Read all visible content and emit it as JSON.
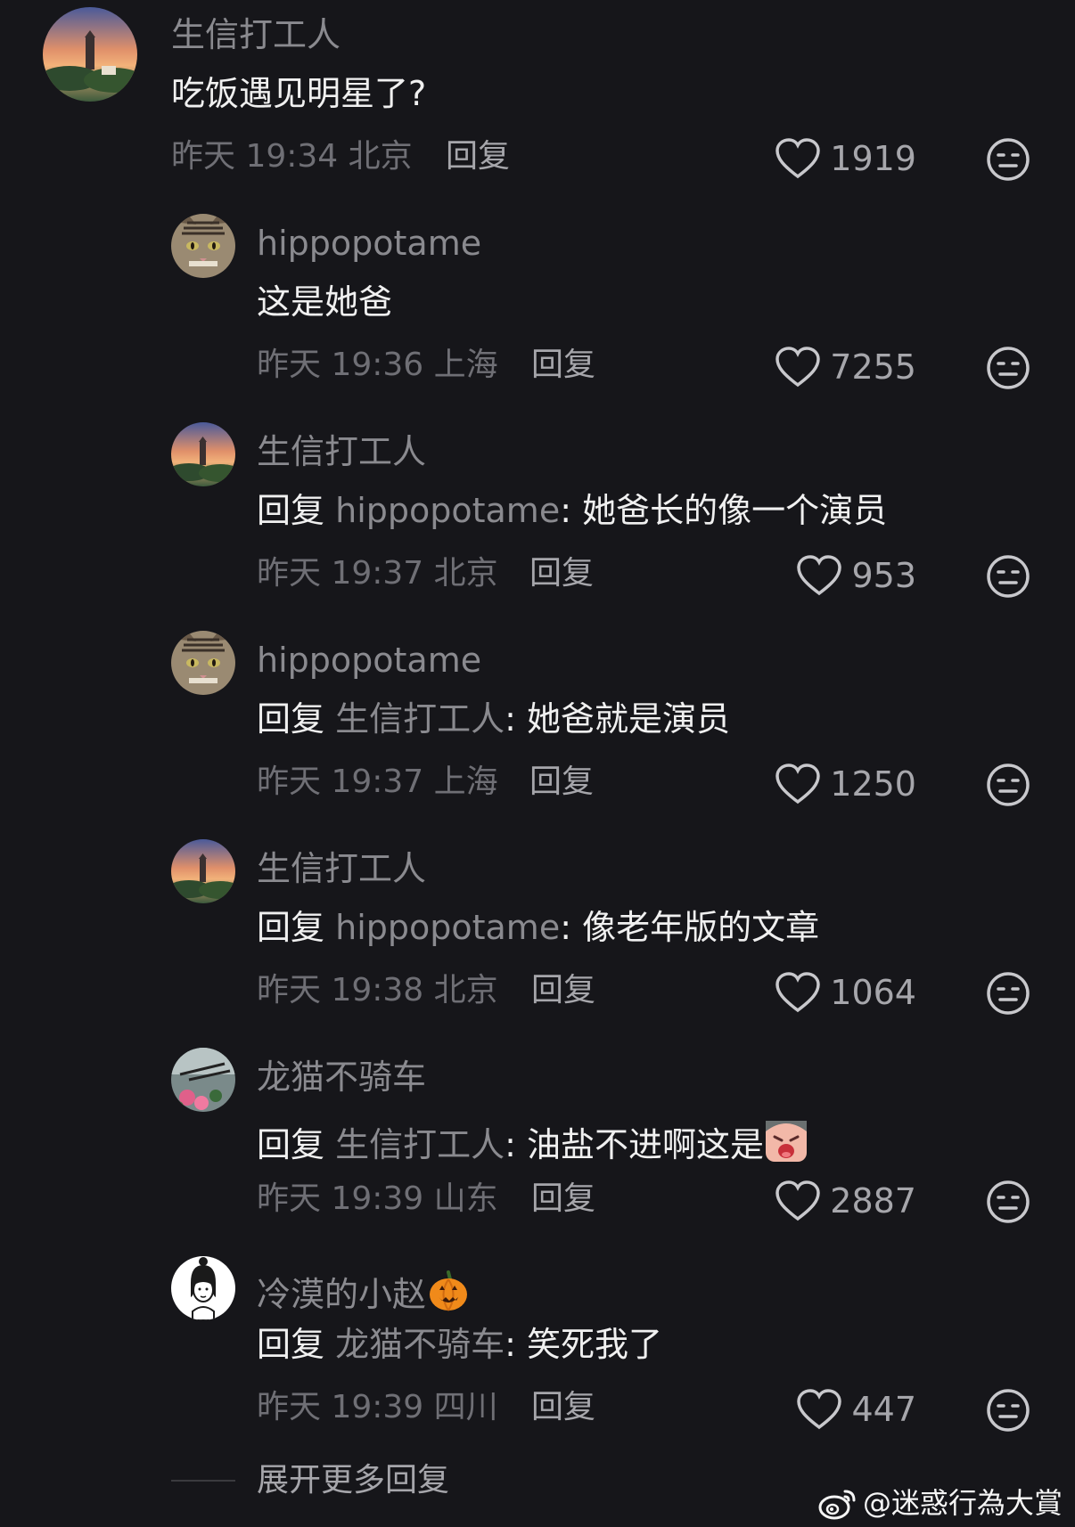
{
  "comments": [
    {
      "username": "生信打工人",
      "text": "吃饭遇见明星了?",
      "reply_prefix": "",
      "reply_target": "",
      "time": "昨天 19:34 北京",
      "reply_label": "回复",
      "likes": "1919",
      "avatar": "sunset-tower-avatar"
    },
    {
      "username": "hippopotame",
      "text": "这是她爸",
      "reply_prefix": "",
      "reply_target": "",
      "time": "昨天 19:36 上海",
      "reply_label": "回复",
      "likes": "7255",
      "avatar": "cat-avatar"
    },
    {
      "username": "生信打工人",
      "text": "她爸长的像一个演员",
      "reply_prefix": "回复",
      "reply_target": "hippopotame",
      "time": "昨天 19:37 北京",
      "reply_label": "回复",
      "likes": "953",
      "avatar": "sunset-tower-avatar"
    },
    {
      "username": "hippopotame",
      "text": "她爸就是演员",
      "reply_prefix": "回复",
      "reply_target": "生信打工人",
      "time": "昨天 19:37 上海",
      "reply_label": "回复",
      "likes": "1250",
      "avatar": "cat-avatar"
    },
    {
      "username": "生信打工人",
      "text": "像老年版的文章",
      "reply_prefix": "回复",
      "reply_target": "hippopotame",
      "time": "昨天 19:38 北京",
      "reply_label": "回复",
      "likes": "1064",
      "avatar": "sunset-tower-avatar"
    },
    {
      "username": "龙猫不骑车",
      "text": "油盐不进啊这是",
      "reply_prefix": "回复",
      "reply_target": "生信打工人",
      "time": "昨天 19:39 山东",
      "reply_label": "回复",
      "likes": "2887",
      "avatar": "flowers-avatar",
      "trailing_emoji": "crying-face-emoji"
    },
    {
      "username": "冷漠的小赵",
      "text": "笑死我了",
      "reply_prefix": "回复",
      "reply_target": "龙猫不骑车",
      "time": "昨天 19:39 四川",
      "reply_label": "回复",
      "likes": "447",
      "avatar": "sketch-girl-avatar",
      "username_emoji": "pumpkin-emoji"
    }
  ],
  "expand_more_label": "展开更多回复",
  "watermark": "@迷惑行為大賞",
  "colors": {
    "background": "#16161a",
    "username": "#8a8a8f",
    "content": "#f0f0f0",
    "meta": "#6f6f75"
  }
}
